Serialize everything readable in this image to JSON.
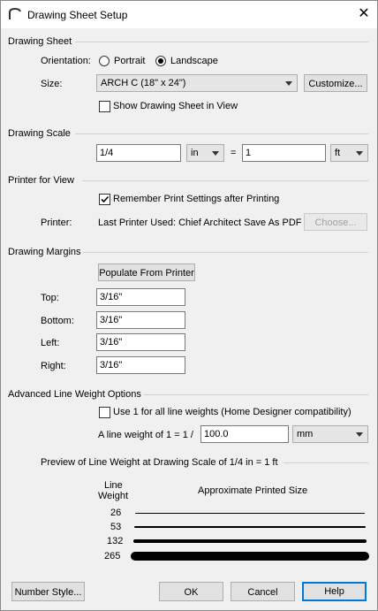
{
  "window": {
    "title": "Drawing Sheet Setup"
  },
  "drawing_sheet": {
    "header": "Drawing Sheet",
    "orientation_label": "Orientation:",
    "portrait_label": "Portrait",
    "landscape_label": "Landscape",
    "orientation_selected": "Landscape",
    "size_label": "Size:",
    "size_value": "ARCH C  (18\" x 24\")",
    "customize_button": "Customize...",
    "show_sheet_label": "Show Drawing Sheet in View",
    "show_sheet_checked": false
  },
  "drawing_scale": {
    "header": "Drawing Scale",
    "left_value": "1/4",
    "left_unit": "in",
    "equals": "=",
    "right_value": "1",
    "right_unit": "ft"
  },
  "printer": {
    "header": "Printer for View",
    "remember_label": "Remember Print Settings after Printing",
    "remember_checked": true,
    "printer_label": "Printer:",
    "printer_value": "Last Printer Used:  Chief Architect Save As PDF",
    "choose_button": "Choose..."
  },
  "margins": {
    "header": "Drawing Margins",
    "populate_button": "Populate From Printer",
    "top_label": "Top:",
    "top_value": "3/16\"",
    "bottom_label": "Bottom:",
    "bottom_value": "3/16\"",
    "left_label": "Left:",
    "left_value": "3/16\"",
    "right_label": "Right:",
    "right_value": "3/16\""
  },
  "line_weight": {
    "header": "Advanced Line Weight Options",
    "use1_label": "Use 1 for all line weights (Home Designer compatibility)",
    "use1_checked": false,
    "weight_label": "A line weight of 1 = 1 /",
    "weight_value": "100.0",
    "weight_unit": "mm",
    "preview_header": "Preview of Line Weight at Drawing Scale of  1/4 in = 1 ft",
    "col_weight_1": "Line",
    "col_weight_2": "Weight",
    "col_size": "Approximate Printed Size",
    "rows": [
      {
        "weight": "26"
      },
      {
        "weight": "53"
      },
      {
        "weight": "132"
      },
      {
        "weight": "265"
      }
    ]
  },
  "footer": {
    "number_style_button": "Number Style...",
    "ok_button": "OK",
    "cancel_button": "Cancel",
    "help_button": "Help"
  }
}
